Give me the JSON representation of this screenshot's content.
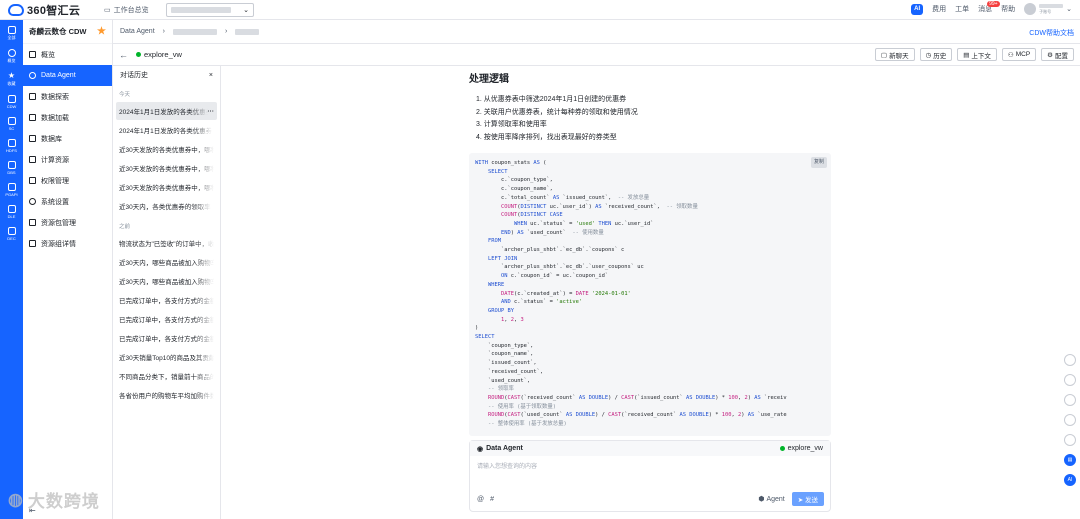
{
  "brand": {
    "logo": "360智汇云",
    "workbench": "工作台总览"
  },
  "header": {
    "fees": "费用",
    "tickets": "工单",
    "messages": "消息",
    "messages_badge": "99+",
    "help": "帮助",
    "account": "子账号"
  },
  "sidebar": {
    "title": "奇麟云数仓 CDW",
    "items": [
      {
        "label": "概览"
      },
      {
        "label": "Data Agent"
      },
      {
        "label": "数据探索"
      },
      {
        "label": "数据加载"
      },
      {
        "label": "数据库"
      },
      {
        "label": "计算资源"
      },
      {
        "label": "权限管理"
      },
      {
        "label": "系统设置"
      },
      {
        "label": "资源包管理"
      },
      {
        "label": "资源组详情"
      }
    ]
  },
  "rail": {
    "items": [
      "全部",
      "概览",
      "收藏",
      "CDW",
      "SC",
      "HDFS",
      "DBS",
      "PGAPI",
      "DLE",
      "DEC"
    ]
  },
  "breadcrumb": {
    "section": "Data Agent",
    "help": "CDW帮助文档"
  },
  "toolbar": {
    "name": "explore_vw",
    "new_chat": "新聊天",
    "history": "历史",
    "context": "上下文",
    "mcp": "MCP",
    "config": "配置"
  },
  "history": {
    "title": "对话历史",
    "groups": [
      {
        "label": "今天",
        "items": [
          "2024年1月1日发放的各类优惠券",
          "2024年1月1日发放的各类优惠券",
          "近30天发放的各类优惠券中，哪种",
          "近30天发放的各类优惠券中，哪种",
          "近30天发放的各类优惠券中，哪种",
          "近30天内，各类优惠券的领取率"
        ]
      },
      {
        "label": "之前",
        "items": [
          "物流状态为\"已签收\"的订单中，收",
          "近30天内，哪些商品被加入购物车",
          "近30天内，哪些商品被加入购物车",
          "已完成订单中，各支付方式的金额",
          "已完成订单中，各支付方式的金额",
          "已完成订单中，各支付方式的金额",
          "近30天销量Top10的商品及其贡献",
          "不同商品分类下，销量前十商品的",
          "各省份用户的购物车平均加购件数"
        ]
      }
    ]
  },
  "content": {
    "heading": "处理逻辑",
    "steps": [
      "1. 从优惠券表中筛选2024年1月1日创建的优惠券",
      "2. 关联用户优惠券表，统计每种券的领取和使用情况",
      "3. 计算领取率和使用率",
      "4. 按使用率降序排列，找出表现最好的券类型"
    ],
    "copy": "复制"
  },
  "chat": {
    "title": "Data Agent",
    "workspace": "explore_vw",
    "placeholder": "请输入您想查询的内容",
    "agent": "Agent",
    "send": "发送"
  },
  "watermark": "大数跨境"
}
